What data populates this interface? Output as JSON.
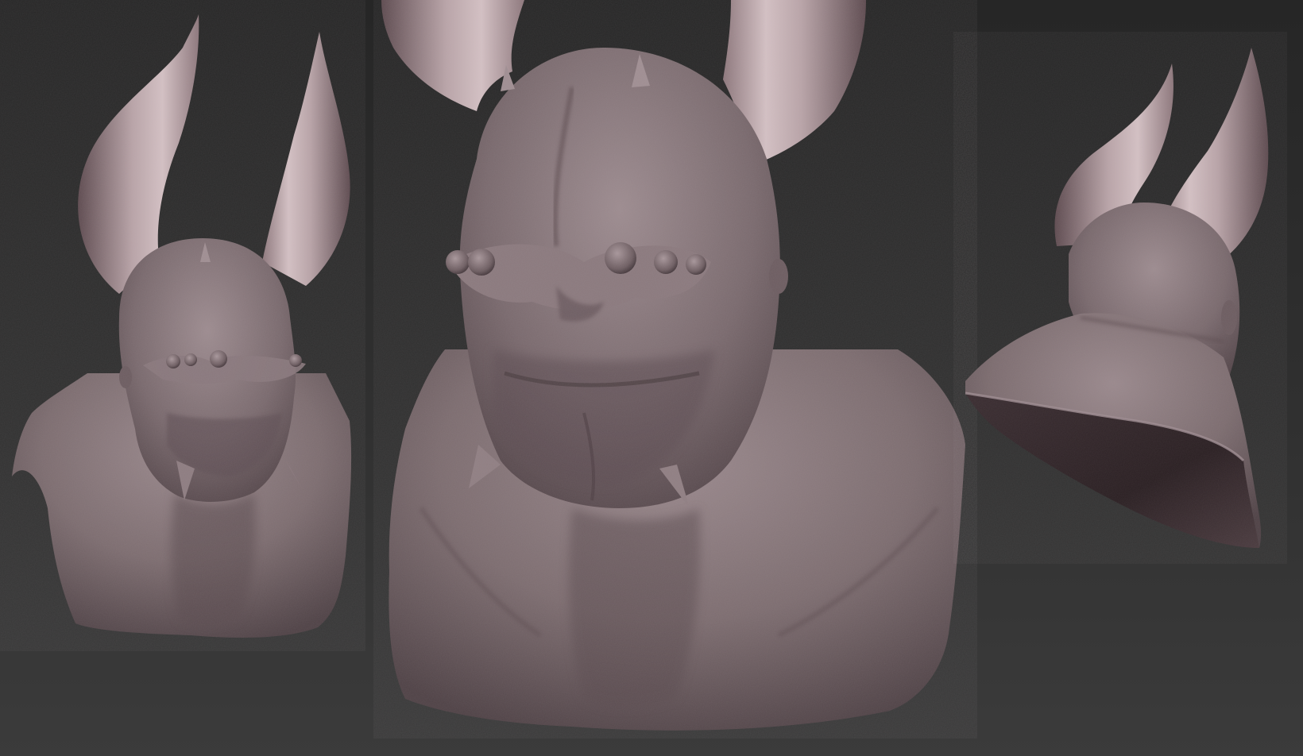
{
  "scene": {
    "description_tag": "3d-sculpt-render",
    "views": [
      {
        "name": "front-view-small",
        "label": "front"
      },
      {
        "name": "front-view-large",
        "label": "front-closeup"
      },
      {
        "name": "back-three-quarter-view",
        "label": "back-three-quarter"
      }
    ]
  },
  "colors": {
    "background_top": "#2a2a2a",
    "background_bottom": "#3a3a3a",
    "clay_base": "#7d6d70",
    "clay_light": "#a39196",
    "clay_shadow": "#4c3f43",
    "horn_base": "#9e888c",
    "horn_light": "#cdb9bc",
    "horn_shadow": "#5e4b50",
    "cavity": "#2f2326"
  }
}
